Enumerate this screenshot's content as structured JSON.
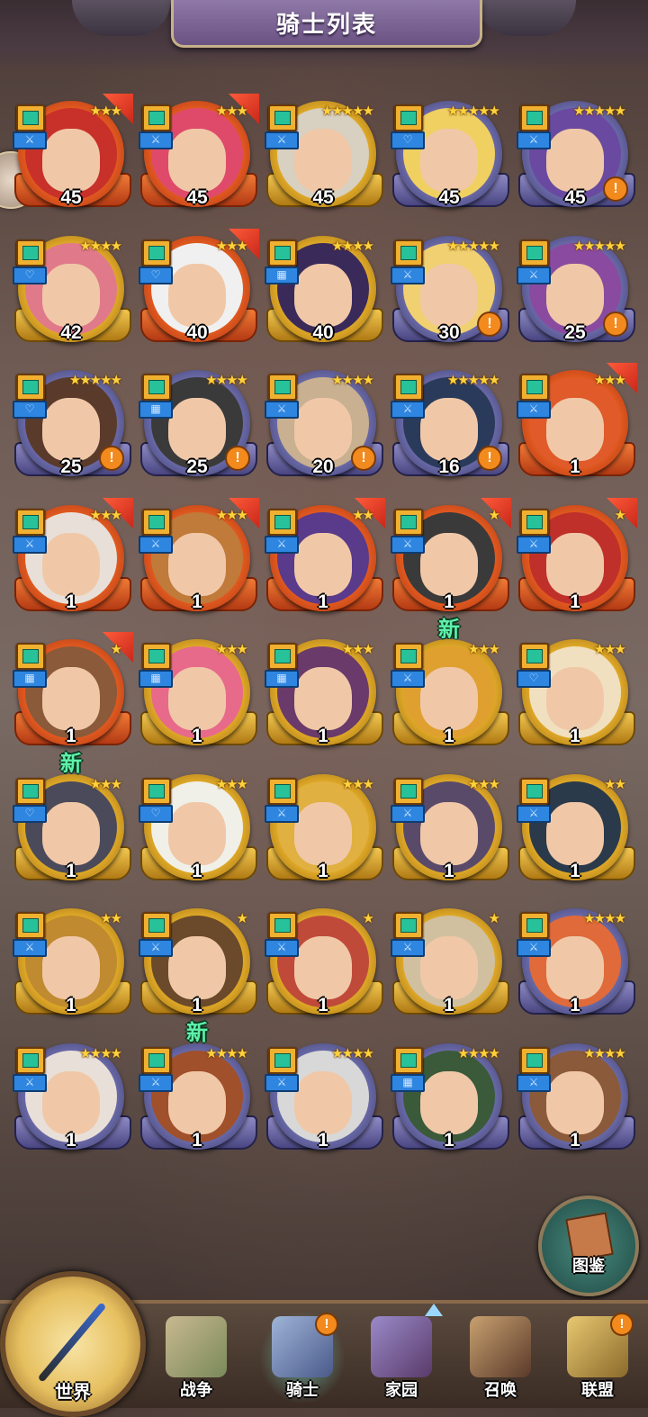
{
  "header": {
    "title": "骑士列表"
  },
  "codex": {
    "label": "图鉴"
  },
  "nav": {
    "world": "世界",
    "items": [
      {
        "label": "战争",
        "alert": ""
      },
      {
        "label": "骑士",
        "alert": "!"
      },
      {
        "label": "家园",
        "alert": ""
      },
      {
        "label": "召唤",
        "alert": ""
      },
      {
        "label": "联盟",
        "alert": "!"
      }
    ]
  },
  "knights": [
    {
      "level": "45",
      "stars": "★★★",
      "frame": "red",
      "alert": "",
      "new": "",
      "cls": "⚔"
    },
    {
      "level": "45",
      "stars": "★★★",
      "frame": "red",
      "alert": "",
      "new": "",
      "cls": "⚔"
    },
    {
      "level": "45",
      "stars": "★★★★★",
      "frame": "gold",
      "alert": "",
      "new": "",
      "cls": "⚔"
    },
    {
      "level": "45",
      "stars": "★★★★★",
      "frame": "purple",
      "alert": "",
      "new": "",
      "cls": "♡"
    },
    {
      "level": "45",
      "stars": "★★★★★",
      "frame": "purple",
      "alert": "!",
      "new": "",
      "cls": "⚔"
    },
    {
      "level": "42",
      "stars": "★★★★",
      "frame": "gold",
      "alert": "",
      "new": "",
      "cls": "♡"
    },
    {
      "level": "40",
      "stars": "★★★",
      "frame": "red",
      "alert": "",
      "new": "",
      "cls": "♡"
    },
    {
      "level": "40",
      "stars": "★★★★",
      "frame": "gold",
      "alert": "",
      "new": "",
      "cls": "▦"
    },
    {
      "level": "30",
      "stars": "★★★★★",
      "frame": "purple",
      "alert": "!",
      "new": "",
      "cls": "⚔"
    },
    {
      "level": "25",
      "stars": "★★★★★",
      "frame": "purple",
      "alert": "!",
      "new": "",
      "cls": "⚔"
    },
    {
      "level": "25",
      "stars": "★★★★★",
      "frame": "purple",
      "alert": "!",
      "new": "",
      "cls": "♡"
    },
    {
      "level": "25",
      "stars": "★★★★",
      "frame": "purple",
      "alert": "!",
      "new": "",
      "cls": "▦"
    },
    {
      "level": "20",
      "stars": "★★★★",
      "frame": "purple",
      "alert": "!",
      "new": "",
      "cls": "⚔"
    },
    {
      "level": "16",
      "stars": "★★★★★",
      "frame": "purple",
      "alert": "!",
      "new": "",
      "cls": "⚔"
    },
    {
      "level": "1",
      "stars": "★★★",
      "frame": "red",
      "alert": "",
      "new": "",
      "cls": "⚔"
    },
    {
      "level": "1",
      "stars": "★★★",
      "frame": "red",
      "alert": "",
      "new": "",
      "cls": "⚔"
    },
    {
      "level": "1",
      "stars": "★★★",
      "frame": "red",
      "alert": "",
      "new": "",
      "cls": "⚔"
    },
    {
      "level": "1",
      "stars": "★★",
      "frame": "red",
      "alert": "",
      "new": "",
      "cls": "⚔"
    },
    {
      "level": "1",
      "stars": "★",
      "frame": "red",
      "alert": "",
      "new": "新",
      "cls": "⚔"
    },
    {
      "level": "1",
      "stars": "★",
      "frame": "red",
      "alert": "",
      "new": "",
      "cls": "⚔"
    },
    {
      "level": "1",
      "stars": "★",
      "frame": "red",
      "alert": "",
      "new": "新",
      "cls": "▦"
    },
    {
      "level": "1",
      "stars": "★★★",
      "frame": "gold",
      "alert": "",
      "new": "",
      "cls": "▦"
    },
    {
      "level": "1",
      "stars": "★★★",
      "frame": "gold",
      "alert": "",
      "new": "",
      "cls": "▦"
    },
    {
      "level": "1",
      "stars": "★★★",
      "frame": "gold",
      "alert": "",
      "new": "",
      "cls": "⚔"
    },
    {
      "level": "1",
      "stars": "★★★",
      "frame": "gold",
      "alert": "",
      "new": "",
      "cls": "♡"
    },
    {
      "level": "1",
      "stars": "★★★",
      "frame": "gold",
      "alert": "",
      "new": "",
      "cls": "♡"
    },
    {
      "level": "1",
      "stars": "★★★",
      "frame": "gold",
      "alert": "",
      "new": "",
      "cls": "♡"
    },
    {
      "level": "1",
      "stars": "★★★",
      "frame": "gold",
      "alert": "",
      "new": "",
      "cls": "⚔"
    },
    {
      "level": "1",
      "stars": "★★★",
      "frame": "gold",
      "alert": "",
      "new": "",
      "cls": "⚔"
    },
    {
      "level": "1",
      "stars": "★★",
      "frame": "gold",
      "alert": "",
      "new": "",
      "cls": "⚔"
    },
    {
      "level": "1",
      "stars": "★★",
      "frame": "gold",
      "alert": "",
      "new": "",
      "cls": "⚔"
    },
    {
      "level": "1",
      "stars": "★",
      "frame": "gold",
      "alert": "",
      "new": "新",
      "cls": "⚔"
    },
    {
      "level": "1",
      "stars": "★",
      "frame": "gold",
      "alert": "",
      "new": "",
      "cls": "⚔"
    },
    {
      "level": "1",
      "stars": "★",
      "frame": "gold",
      "alert": "",
      "new": "",
      "cls": "⚔"
    },
    {
      "level": "1",
      "stars": "★★★★",
      "frame": "purple",
      "alert": "",
      "new": "",
      "cls": "⚔"
    },
    {
      "level": "1",
      "stars": "★★★★",
      "frame": "purple",
      "alert": "",
      "new": "",
      "cls": "⚔"
    },
    {
      "level": "1",
      "stars": "★★★★",
      "frame": "purple",
      "alert": "",
      "new": "",
      "cls": "⚔"
    },
    {
      "level": "1",
      "stars": "★★★★",
      "frame": "purple",
      "alert": "",
      "new": "",
      "cls": "⚔"
    },
    {
      "level": "1",
      "stars": "★★★★",
      "frame": "purple",
      "alert": "",
      "new": "",
      "cls": "▦"
    },
    {
      "level": "1",
      "stars": "★★★★",
      "frame": "purple",
      "alert": "",
      "new": "",
      "cls": "⚔"
    }
  ],
  "colors": {
    "title_plate": "#7a6294",
    "new_tag": "#5ff0a8",
    "alert": "#f28a1e"
  }
}
